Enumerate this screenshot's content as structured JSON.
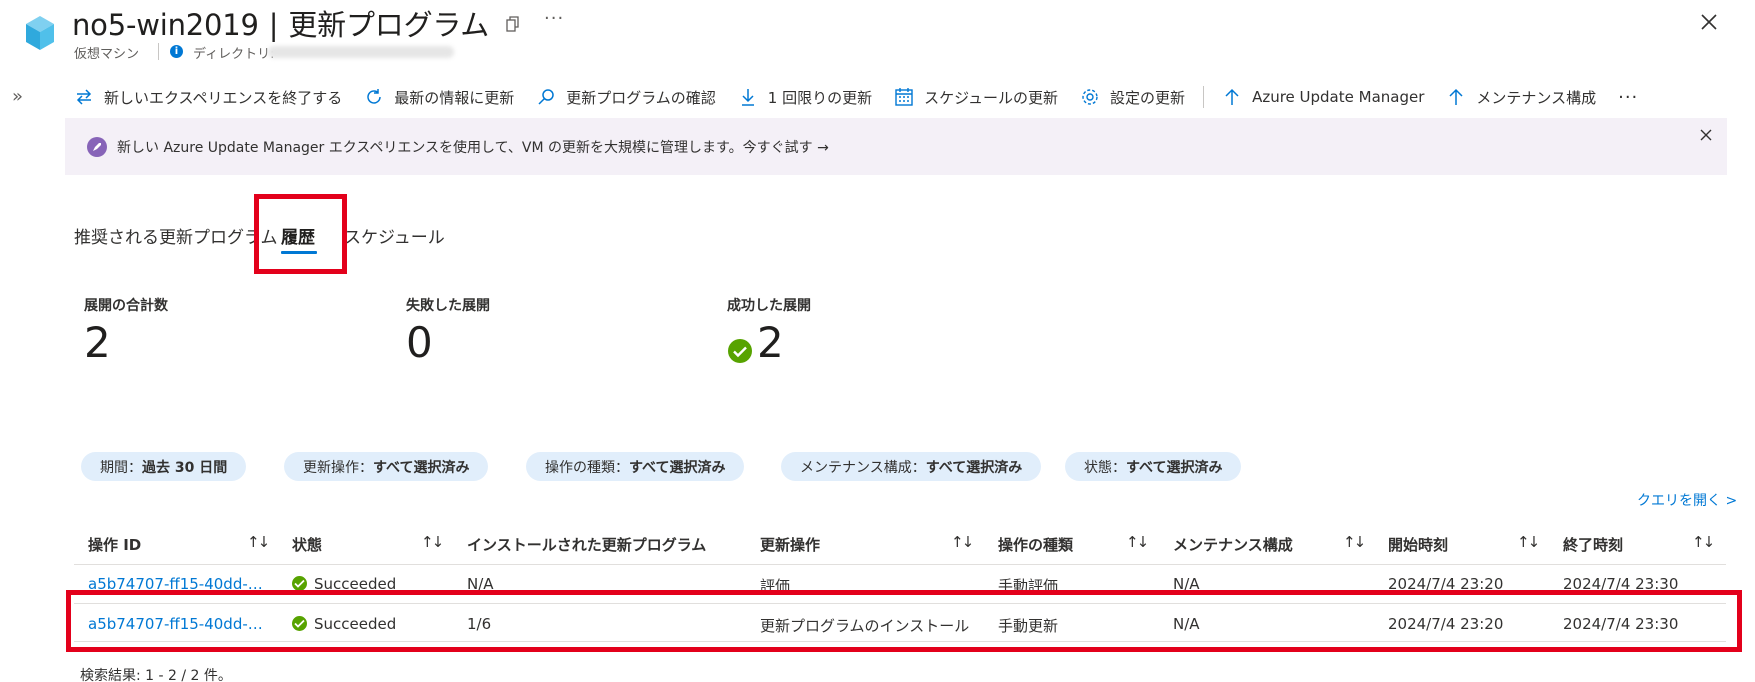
{
  "header": {
    "title": "no5-win2019",
    "title_separator": "|",
    "page_name": "更新プログラム",
    "subtitle": "仮想マシン",
    "directory_label": "ディレクトリ:"
  },
  "toolbar": {
    "items": [
      {
        "label": "新しいエクスペリエンスを終了する",
        "icon": "swap-icon"
      },
      {
        "label": "最新の情報に更新",
        "icon": "refresh-icon"
      },
      {
        "label": "更新プログラムの確認",
        "icon": "search-icon"
      },
      {
        "label": "1 回限りの更新",
        "icon": "download-icon"
      },
      {
        "label": "スケジュールの更新",
        "icon": "calendar-icon"
      },
      {
        "label": "設定の更新",
        "icon": "gear-icon"
      },
      {
        "label": "Azure Update Manager",
        "icon": "arrow-up-icon"
      },
      {
        "label": "メンテナンス構成",
        "icon": "arrow-up-icon"
      }
    ],
    "more": "···"
  },
  "banner": {
    "text": "新しい Azure Update Manager エクスペリエンスを使用して、VM の更新を大規模に管理します。今すぐ試す →"
  },
  "tabs": [
    {
      "label": "推奨される更新プログラム",
      "active": false
    },
    {
      "label": "履歴",
      "active": true
    },
    {
      "label": "スケジュール",
      "active": false
    }
  ],
  "stats": [
    {
      "label": "展開の合計数",
      "value": "2"
    },
    {
      "label": "失敗した展開",
      "value": "0"
    },
    {
      "label": "成功した展開",
      "value": "2"
    }
  ],
  "filters": [
    {
      "name": "期間：",
      "value": "過去 30 日間"
    },
    {
      "name": "更新操作：",
      "value": "すべて選択済み"
    },
    {
      "name": "操作の種類：",
      "value": "すべて選択済み"
    },
    {
      "name": "メンテナンス構成：",
      "value": "すべて選択済み"
    },
    {
      "name": "状態：",
      "value": "すべて選択済み"
    }
  ],
  "query_link": "クエリを開く >",
  "table": {
    "columns": [
      "操作 ID",
      "状態",
      "インストールされた更新プログラム",
      "更新操作",
      "操作の種類",
      "メンテナンス構成",
      "開始時刻",
      "終了時刻"
    ],
    "sort_icon": "↑↓",
    "rows": [
      [
        "a5b74707-ff15-40dd-…",
        "Succeeded",
        "N/A",
        "評価",
        "手動評価",
        "N/A",
        "2024/7/4 23:20",
        "2024/7/4 23:30"
      ],
      [
        "a5b74707-ff15-40dd-…",
        "Succeeded",
        "1/6",
        "更新プログラムのインストール",
        "手動更新",
        "N/A",
        "2024/7/4 23:20",
        "2024/7/4 23:30"
      ]
    ]
  },
  "results_text": "検索結果: 1 - 2 / 2 件。",
  "colors": {
    "accent": "#0078d4",
    "success": "#57a300",
    "highlight_box": "#e3001b",
    "banner_bg": "#f4f0f7",
    "pill_bg": "#e1eefb"
  }
}
